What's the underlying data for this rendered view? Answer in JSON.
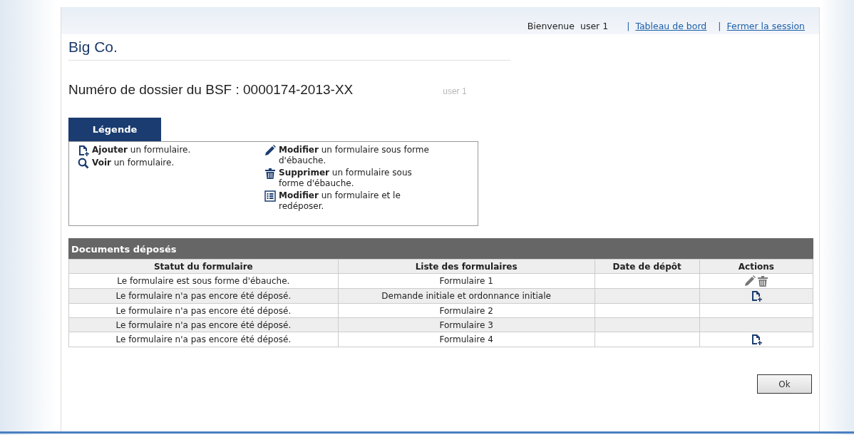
{
  "header": {
    "welcome": "Bienvenue",
    "user": "user 1",
    "links": [
      {
        "separator": "|",
        "label": "Tableau de bord"
      },
      {
        "separator": "|",
        "label": "Fermer la session"
      }
    ]
  },
  "company": "Big Co.",
  "dossier": {
    "title": "Numéro de dossier du BSF : 0000174-2013-XX",
    "ghost_text": "user 1"
  },
  "legend": {
    "tab": "Légende",
    "columns": [
      [
        {
          "kind": "add",
          "text": "**Ajouter** un formulaire."
        },
        {
          "kind": "view",
          "text": "**Voir** un formulaire."
        }
      ],
      [
        {
          "kind": "edit",
          "text": "**Modifier** un formulaire sous forme d'ébauche."
        },
        {
          "kind": "delete",
          "text": "**Supprimer** un formulaire sous forme d'ébauche."
        },
        {
          "kind": "list",
          "text": "**Modifier** un formulaire et le redéposer."
        }
      ]
    ]
  },
  "documents": {
    "title": "Documents déposés",
    "columns": [
      "Statut du formulaire",
      "Liste des formulaires",
      "Date de dépôt",
      "Actions"
    ],
    "rows": [
      {
        "status": "Le formulaire est sous forme d'ébauche.",
        "form": "Formulaire 1",
        "actions": [
          {
            "kind": "edit"
          },
          {
            "kind": "delete"
          }
        ]
      },
      {
        "status": "Le formulaire n'a pas encore été déposé.",
        "form": "Demande initiale et ordonnance initiale",
        "actions": [
          {
            "kind": "add"
          }
        ]
      },
      {
        "status": "Le formulaire n'a pas encore été déposé.",
        "form": "Formulaire 2",
        "actions": []
      },
      {
        "status": "Le formulaire n'a pas encore été déposé.",
        "form": "Formulaire 3",
        "actions": []
      },
      {
        "status": "Le formulaire n'a pas encore été déposé.",
        "form": "Formulaire 4",
        "actions": [
          {
            "kind": "add"
          }
        ]
      }
    ]
  },
  "buttons": [
    "Ok"
  ]
}
